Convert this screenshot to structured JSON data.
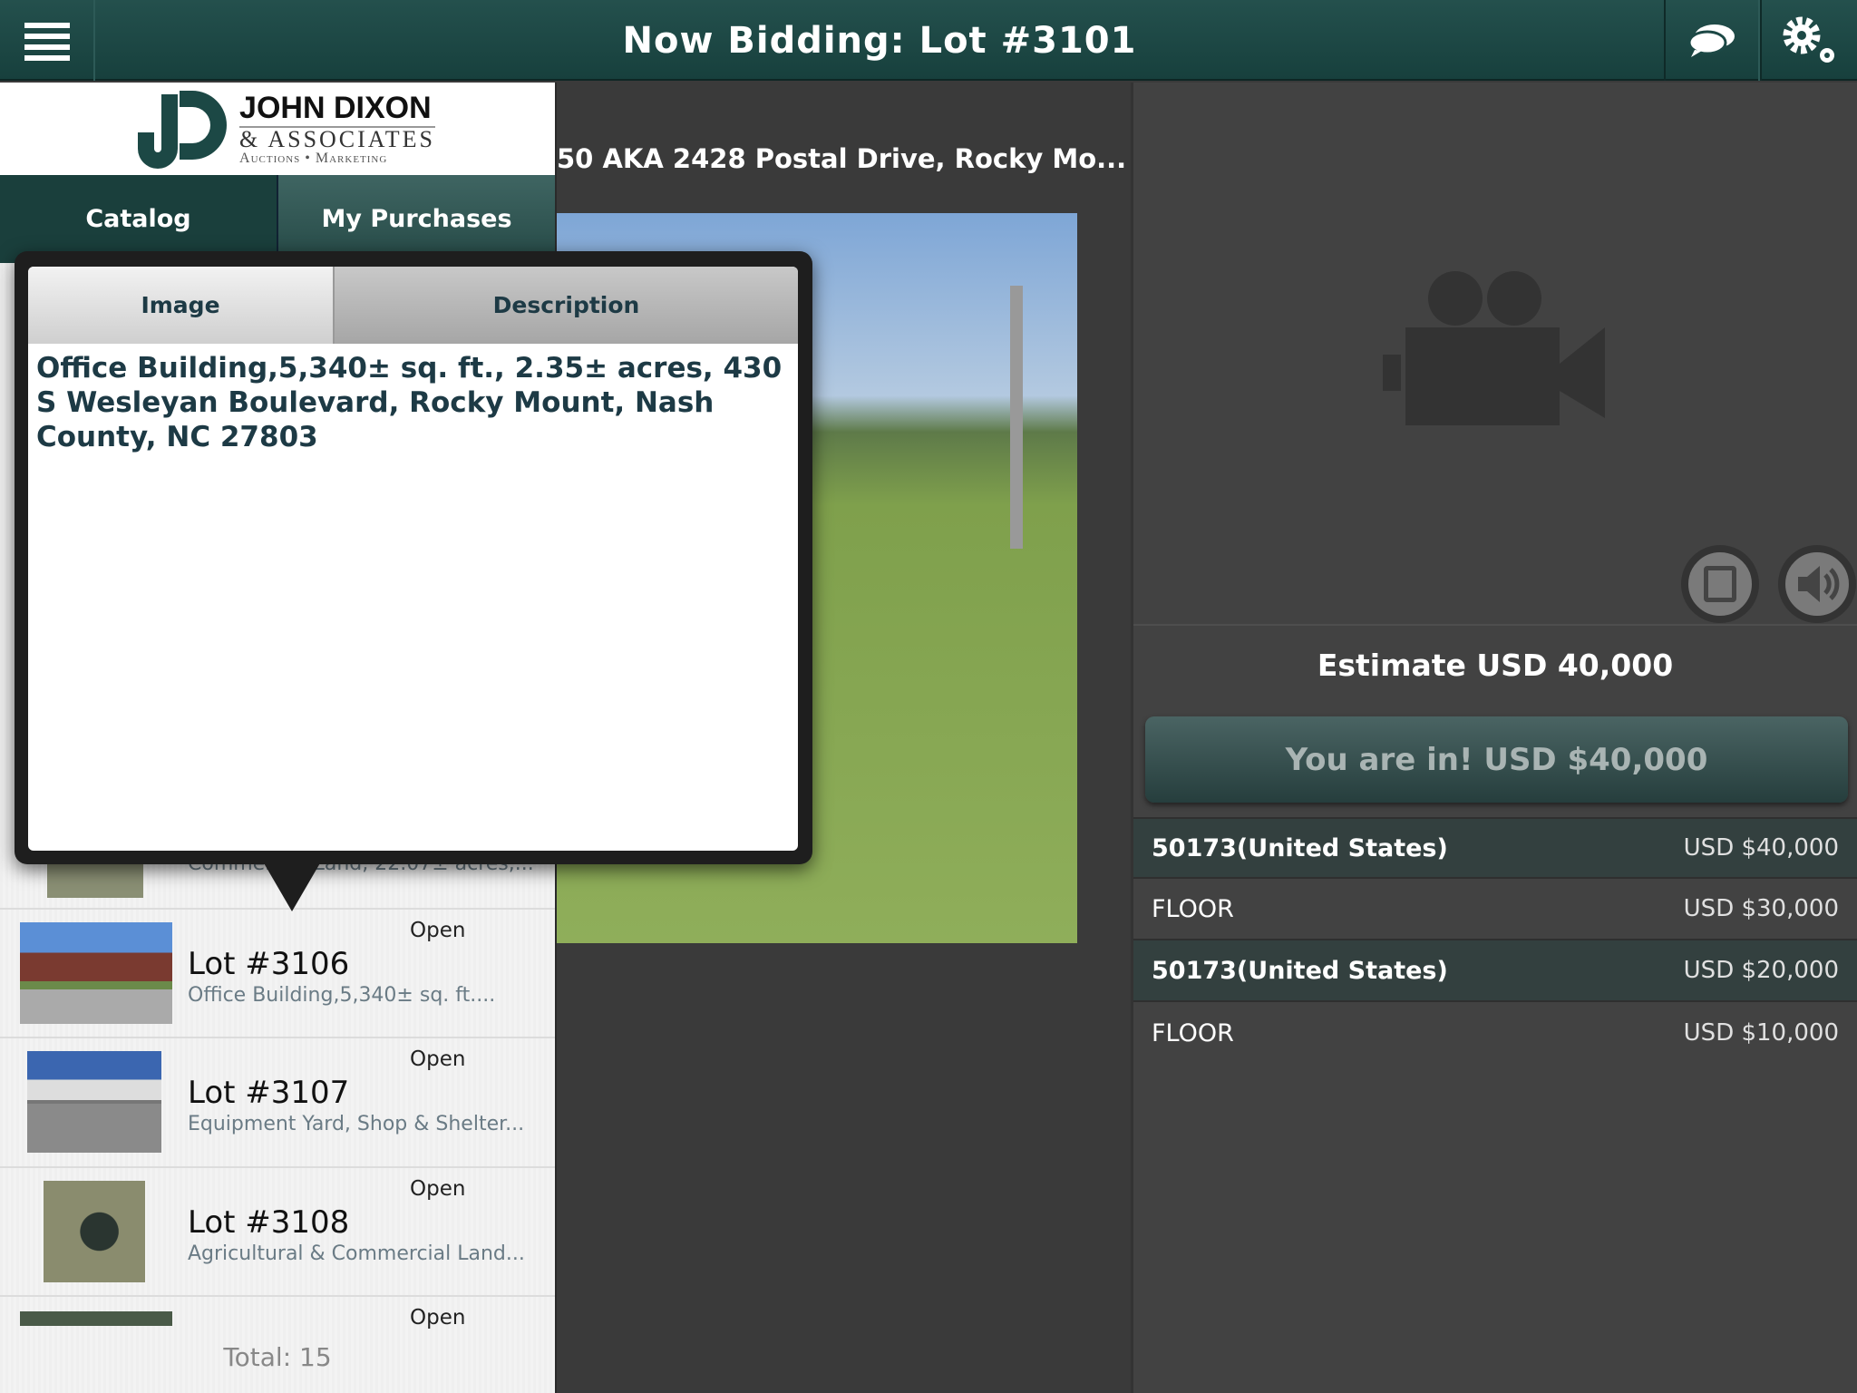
{
  "header": {
    "title": "Now Bidding: Lot #3101",
    "menu_icon": "hamburger-menu-icon",
    "chat_icon": "chat-bubbles-icon",
    "settings_icon": "gears-icon"
  },
  "logo": {
    "line1": "JOHN DIXON",
    "line2": "& ASSOCIATES",
    "line3": "Auctions • Marketing"
  },
  "sidebar": {
    "tabs": [
      {
        "label": "Catalog"
      },
      {
        "label": "My Purchases"
      }
    ],
    "partial_item": {
      "description": "Commercial Land, 22.07± acres,..."
    },
    "items": [
      {
        "lot": "Lot #3106",
        "status": "Open",
        "description": "Office Building,5,340± sq. ft...."
      },
      {
        "lot": "Lot #3107",
        "status": "Open",
        "description": "Equipment Yard, Shop & Shelter..."
      },
      {
        "lot": "Lot #3108",
        "status": "Open",
        "description": "Agricultural & Commercial Land..."
      },
      {
        "status": "Open"
      }
    ],
    "total": "Total: 15"
  },
  "popover": {
    "tabs": [
      {
        "label": "Image"
      },
      {
        "label": "Description"
      }
    ],
    "text": "Office Building,5,340± sq. ft., 2.35± acres, 430 S Wesleyan Boulevard, Rocky Mount, Nash County, NC 27803"
  },
  "main": {
    "address": "50 AKA 2428 Postal Drive, Rocky Mo..."
  },
  "bidding": {
    "estimate": "Estimate USD 40,000",
    "bid_button": "You are in! USD $40,000",
    "history": [
      {
        "bidder": "50173(United States)",
        "amount": "USD $40,000"
      },
      {
        "bidder": "FLOOR",
        "amount": "USD $30,000"
      },
      {
        "bidder": "50173(United States)",
        "amount": "USD $20,000"
      },
      {
        "bidder": "FLOOR",
        "amount": "USD $10,000"
      }
    ]
  },
  "colors": {
    "brand": "#1c4845",
    "accent_button": "#2f4d4c"
  }
}
